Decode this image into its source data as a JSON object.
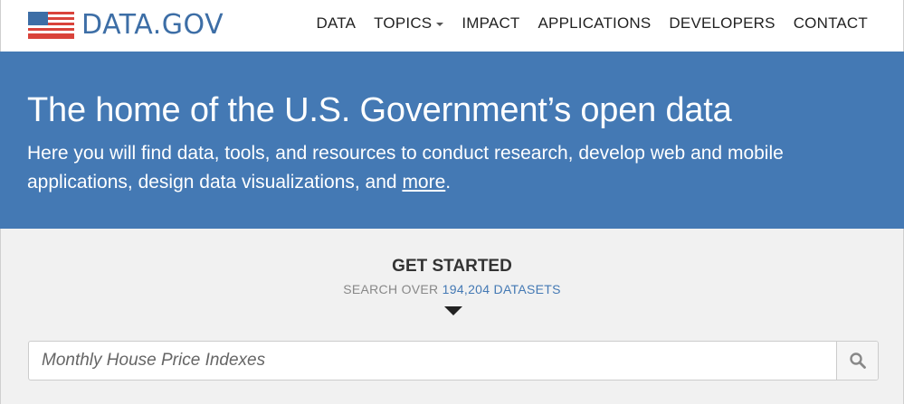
{
  "brand": {
    "name": "DATA.GOV",
    "flag_icon": "us-flag-icon"
  },
  "nav": {
    "items": [
      {
        "label": "DATA"
      },
      {
        "label": "TOPICS",
        "has_dropdown": true
      },
      {
        "label": "IMPACT"
      },
      {
        "label": "APPLICATIONS"
      },
      {
        "label": "DEVELOPERS"
      },
      {
        "label": "CONTACT"
      }
    ]
  },
  "hero": {
    "title": "The home of the U.S. Government’s open data",
    "description": "Here you will find data, tools, and resources to conduct research, develop web and mobile applications, design data visualizations, and ",
    "more_link": "more",
    "period": ".",
    "background_color": "#4479b4"
  },
  "get_started": {
    "heading": "GET STARTED",
    "sub_prefix": "SEARCH OVER ",
    "dataset_count": "194,204 DATASETS",
    "arrow_icon": "caret-down-icon"
  },
  "search": {
    "placeholder": "Monthly House Price Indexes",
    "value": "",
    "button_icon": "search-icon"
  }
}
